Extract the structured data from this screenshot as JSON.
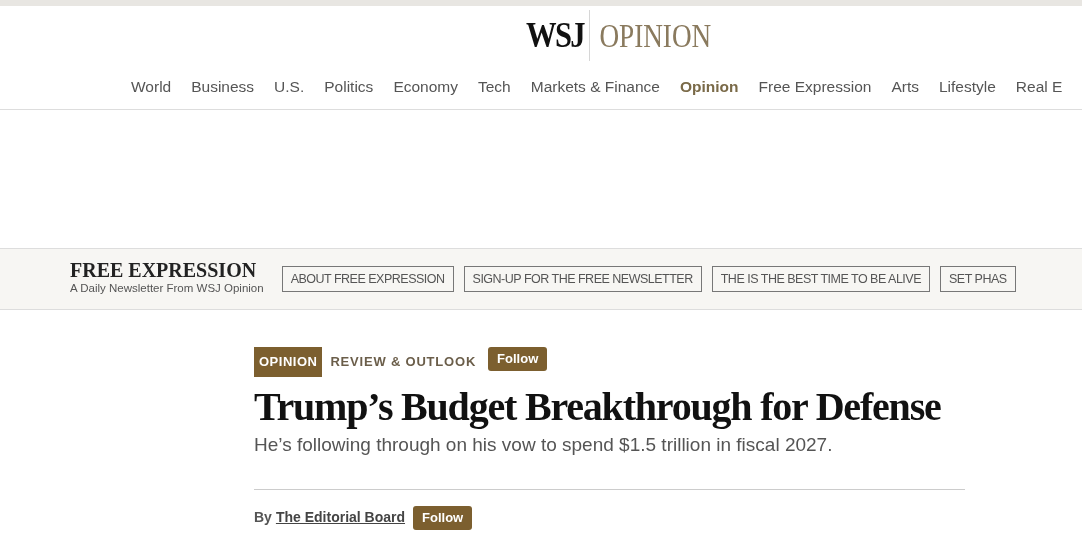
{
  "masthead": {
    "brand": "WSJ",
    "section": "OPINION"
  },
  "nav": [
    {
      "label": "World",
      "selected": false
    },
    {
      "label": "Business",
      "selected": false
    },
    {
      "label": "U.S.",
      "selected": false
    },
    {
      "label": "Politics",
      "selected": false
    },
    {
      "label": "Economy",
      "selected": false
    },
    {
      "label": "Tech",
      "selected": false
    },
    {
      "label": "Markets & Finance",
      "selected": false
    },
    {
      "label": "Opinion",
      "selected": true
    },
    {
      "label": "Free Expression",
      "selected": false
    },
    {
      "label": "Arts",
      "selected": false
    },
    {
      "label": "Lifestyle",
      "selected": false
    },
    {
      "label": "Real E",
      "selected": false
    }
  ],
  "newsletter_bar": {
    "title": "FREE EXPRESSION",
    "subtitle": "A Daily Newsletter From WSJ Opinion",
    "links": [
      "ABOUT FREE EXPRESSION",
      "SIGN-UP FOR THE FREE NEWSLETTER",
      "THE IS THE BEST TIME TO BE ALIVE",
      "SET PHAS"
    ]
  },
  "article": {
    "tag": "OPINION",
    "column": "REVIEW & OUTLOOK",
    "column_follow": "Follow",
    "headline": "Trump’s Budget Breakthrough for Defense",
    "dek": "He’s following through on his vow to spend $1.5 trillion in fiscal 2027.",
    "byline_prefix": "By",
    "author": "The Editorial Board",
    "author_follow": "Follow"
  }
}
